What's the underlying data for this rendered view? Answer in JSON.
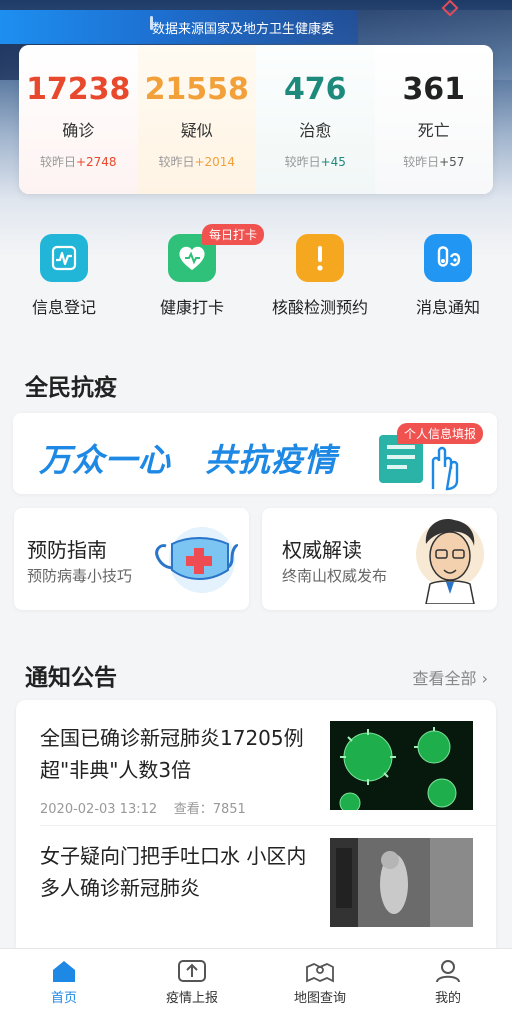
{
  "header": {
    "source_text": "数据来源国家及地方卫生健康委"
  },
  "stats": [
    {
      "value": "17238",
      "label": "确诊",
      "delta_prefix": "较昨日",
      "delta": "+2748",
      "color": "#e8492c"
    },
    {
      "value": "21558",
      "label": "疑似",
      "delta_prefix": "较昨日",
      "delta": "+2014",
      "color": "#f2a03a"
    },
    {
      "value": "476",
      "label": "治愈",
      "delta_prefix": "较昨日",
      "delta": "+45",
      "color": "#1e8a7c"
    },
    {
      "value": "361",
      "label": "死亡",
      "delta_prefix": "较昨日",
      "delta": "+57",
      "color": "#222222"
    }
  ],
  "actions": [
    {
      "label": "信息登记",
      "icon": "chart-icon",
      "color": "#21b5d8"
    },
    {
      "label": "健康打卡",
      "icon": "heart-check-icon",
      "color": "#2fc07a",
      "badge": "每日打卡"
    },
    {
      "label": "核酸检测预约",
      "icon": "exclamation-icon",
      "color": "#f5a71f"
    },
    {
      "label": "消息通知",
      "icon": "notification-icon",
      "color": "#2196f3"
    }
  ],
  "section_fight": {
    "title": "全民抗疫",
    "banner_left": "万众一心",
    "banner_right": "共抗疫情",
    "banner_tag": "个人信息填报"
  },
  "cards": [
    {
      "title": "预防指南",
      "subtitle": "预防病毒小技巧",
      "icon": "mask-icon"
    },
    {
      "title": "权威解读",
      "subtitle": "终南山权威发布",
      "icon": "doctor-avatar-icon"
    }
  ],
  "section_notice": {
    "title": "通知公告",
    "view_all": "查看全部 ›"
  },
  "news": [
    {
      "title": "全国已确诊新冠肺炎17205例 超\"非典\"人数3倍",
      "date": "2020-02-03 13:12",
      "views_label": "查看：",
      "views": "7851"
    },
    {
      "title": "女子疑向门把手吐口水 小区内多人确诊新冠肺炎"
    }
  ],
  "tabbar": [
    {
      "label": "首页",
      "icon": "home-icon",
      "active": true
    },
    {
      "label": "疫情上报",
      "icon": "upload-icon"
    },
    {
      "label": "地图查询",
      "icon": "map-icon"
    },
    {
      "label": "我的",
      "icon": "user-icon"
    }
  ]
}
